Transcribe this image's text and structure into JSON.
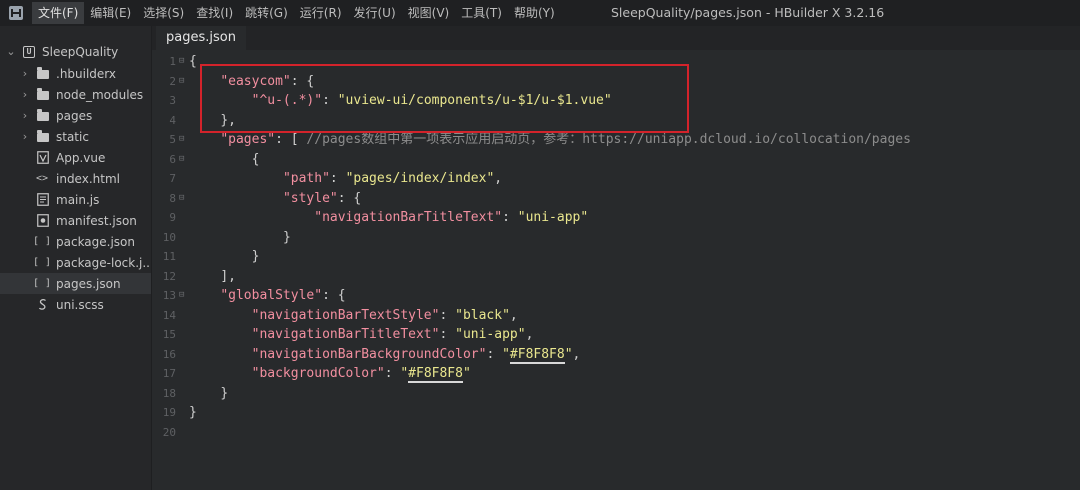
{
  "menu": [
    "文件(F)",
    "编辑(E)",
    "选择(S)",
    "查找(I)",
    "跳转(G)",
    "运行(R)",
    "发行(U)",
    "视图(V)",
    "工具(T)",
    "帮助(Y)"
  ],
  "window_title": "SleepQuality/pages.json - HBuilder X 3.2.16",
  "sidebar": {
    "project": "SleepQuality",
    "items": [
      {
        "label": ".hbuilderx",
        "icon": "folder-icon"
      },
      {
        "label": "node_modules",
        "icon": "folder-icon"
      },
      {
        "label": "pages",
        "icon": "folder-icon"
      },
      {
        "label": "static",
        "icon": "folder-icon"
      },
      {
        "label": "App.vue",
        "icon": "vue-file-icon"
      },
      {
        "label": "index.html",
        "icon": "html-file-icon"
      },
      {
        "label": "main.js",
        "icon": "js-file-icon"
      },
      {
        "label": "manifest.json",
        "icon": "manifest-file-icon"
      },
      {
        "label": "package.json",
        "icon": "json-file-icon"
      },
      {
        "label": "package-lock.j...",
        "icon": "json-file-icon"
      },
      {
        "label": "pages.json",
        "icon": "json-file-icon"
      },
      {
        "label": "uni.scss",
        "icon": "scss-file-icon"
      }
    ],
    "selected": "pages.json"
  },
  "tab": {
    "label": "pages.json"
  },
  "editor": {
    "line_numbers": [
      "1",
      "2",
      "3",
      "4",
      "5",
      "6",
      "7",
      "8",
      "9",
      "10",
      "11",
      "12",
      "13",
      "14",
      "15",
      "16",
      "17",
      "18",
      "19",
      "20"
    ],
    "lines": [
      "{",
      "    \"easycom\": {",
      "        \"^u-(.*)\": \"uview-ui/components/u-$1/u-$1.vue\"",
      "    },",
      "    \"pages\": [ //pages数组中第一项表示应用启动页，参考：https://uniapp.dcloud.io/collocation/pages",
      "        {",
      "            \"path\": \"pages/index/index\",",
      "            \"style\": {",
      "                \"navigationBarTitleText\": \"uni-app\"",
      "            }",
      "        }",
      "    ],",
      "    \"globalStyle\": {",
      "        \"navigationBarTextStyle\": \"black\",",
      "        \"navigationBarTitleText\": \"uni-app\",",
      "        \"navigationBarBackgroundColor\": \"#F8F8F8\",",
      "        \"backgroundColor\": \"#F8F8F8\"",
      "    }",
      "}",
      ""
    ]
  },
  "colors": {
    "highlight_box": "#d3232b",
    "key": "#f28fa0",
    "string": "#e9e68e"
  }
}
